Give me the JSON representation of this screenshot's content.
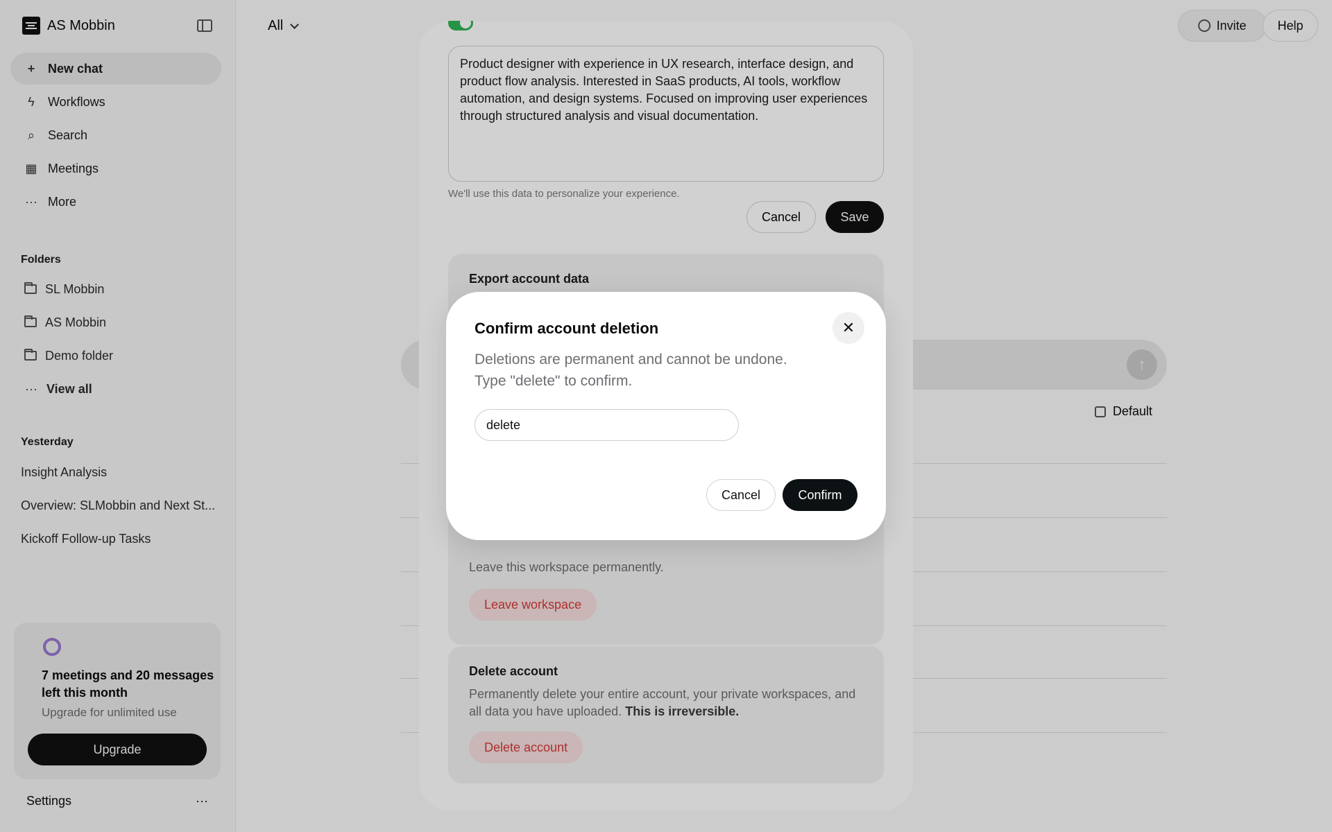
{
  "sidebar": {
    "brand": "AS Mobbin",
    "nav": [
      {
        "label": "New chat",
        "icon": "plus-icon"
      },
      {
        "label": "Workflows",
        "icon": "bolt-icon"
      },
      {
        "label": "Search",
        "icon": "search-icon"
      },
      {
        "label": "Meetings",
        "icon": "calendar-icon"
      },
      {
        "label": "More",
        "icon": "ellipsis-icon"
      }
    ],
    "folders_title": "Folders",
    "folders": [
      "SL Mobbin",
      "AS Mobbin",
      "Demo folder"
    ],
    "view_all": "View all",
    "recent_title": "Yesterday",
    "recent": [
      "Insight Analysis",
      "Overview: SLMobbin and Next St...",
      "Kickoff Follow-up Tasks"
    ],
    "usage": {
      "title": "7 meetings and 20 messages left this month",
      "subtitle": "Upgrade for unlimited use",
      "button": "Upgrade"
    },
    "settings": "Settings"
  },
  "header": {
    "filter": "All",
    "invite": "Invite",
    "help": "Help"
  },
  "main": {
    "model": "Default"
  },
  "settings_panel": {
    "bio": "Product designer with experience in UX research, interface design, and product flow analysis. Interested in SaaS products, AI tools, workflow automation, and design systems. Focused on improving user experiences through structured analysis and visual documentation.",
    "bio_help": "We'll use this data to personalize your experience.",
    "cancel": "Cancel",
    "save": "Save",
    "export_title": "Export account data",
    "leave_desc": "Leave this workspace permanently.",
    "leave_button": "Leave workspace",
    "delete_title": "Delete account",
    "delete_desc": "Permanently delete your entire account, your private workspaces, and all data you have uploaded.",
    "delete_desc_bold": "This is irreversible.",
    "delete_button": "Delete account"
  },
  "dialog": {
    "title": "Confirm account deletion",
    "desc_line1": "Deletions are permanent and cannot be undone.",
    "desc_line2": "Type \"delete\" to confirm.",
    "input_value": "delete",
    "cancel": "Cancel",
    "confirm": "Confirm"
  },
  "colors": {
    "toggle_on": "#30b456",
    "danger": "#d43a3a",
    "primary": "#0c1114"
  }
}
